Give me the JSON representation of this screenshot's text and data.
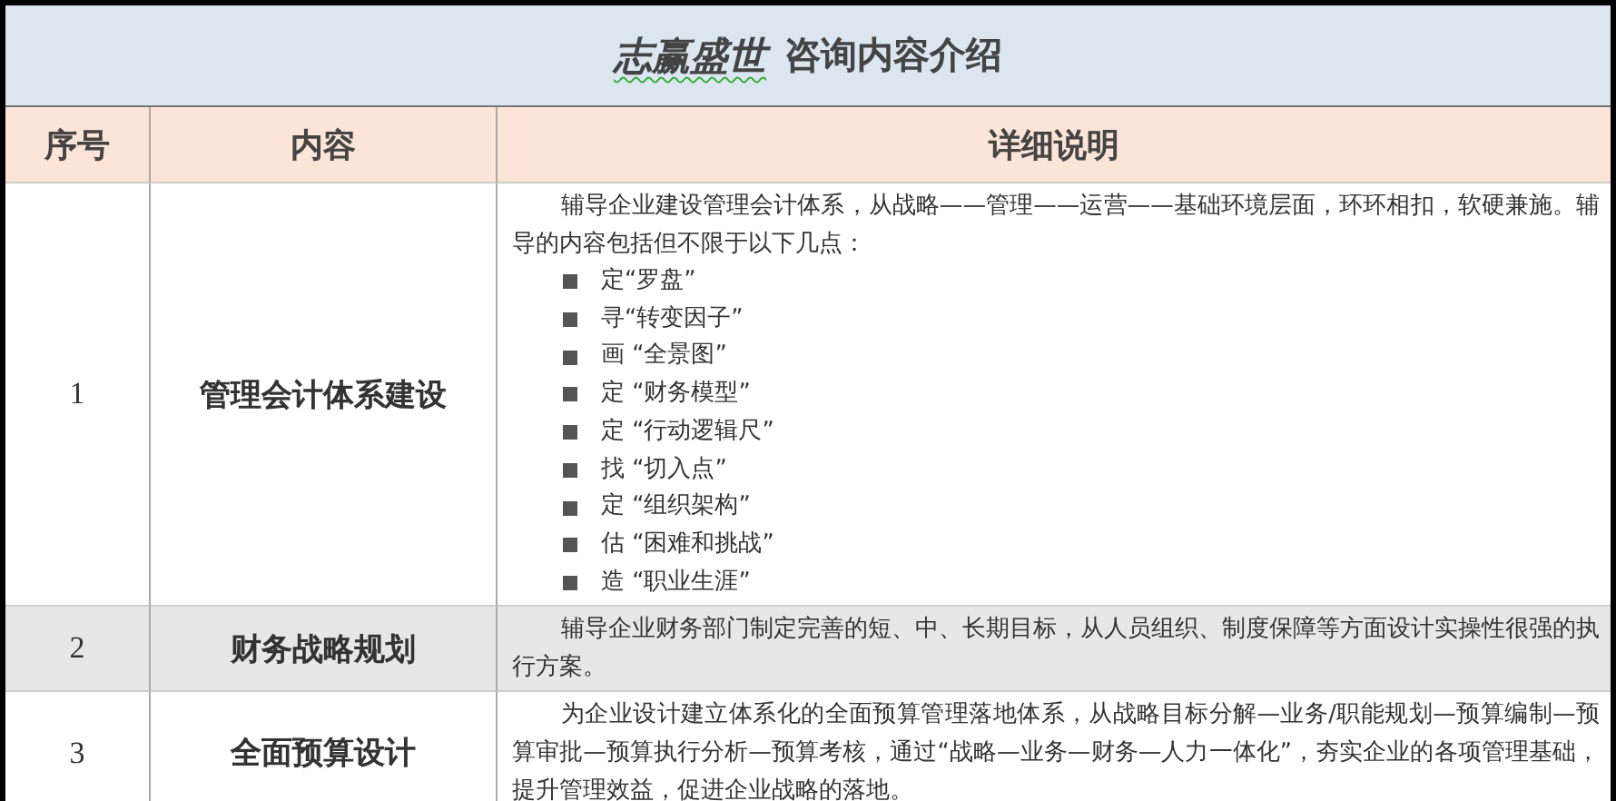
{
  "title": {
    "brand": "志赢盛世",
    "text": "咨询内容介绍"
  },
  "table": {
    "columns": [
      "序号",
      "内容",
      "详细说明"
    ],
    "rows": [
      {
        "number": "1",
        "name": "管理会计体系建设",
        "description": "辅导企业建设管理会计体系，从战略——管理——运营——基础环境层面，环环相扣，软硬兼施。辅导的内容包括但不限于以下几点：",
        "points": [
          "定“罗盘”",
          "寻“转变因子”",
          "画 “全景图”",
          "定 “财务模型”",
          "定 “行动逻辑尺”",
          "找 “切入点”",
          "定 “组织架构”",
          "估 “困难和挑战”",
          "造 “职业生涯”"
        ]
      },
      {
        "number": "2",
        "name": "财务战略规划",
        "description": "辅导企业财务部门制定完善的短、中、长期目标，从人员组织、制度保障等方面设计实操性很强的执行方案。"
      },
      {
        "number": "3",
        "name": "全面预算设计",
        "description": "为企业设计建立体系化的全面预算管理落地体系，从战略目标分解—业务/职能规划—预算编制—预算审批—预算执行分析—预算考核，通过“战略—业务—财务—人力一体化”，夯实企业的各项管理基础，提升管理效益，促进企业战略的落地。"
      }
    ]
  }
}
